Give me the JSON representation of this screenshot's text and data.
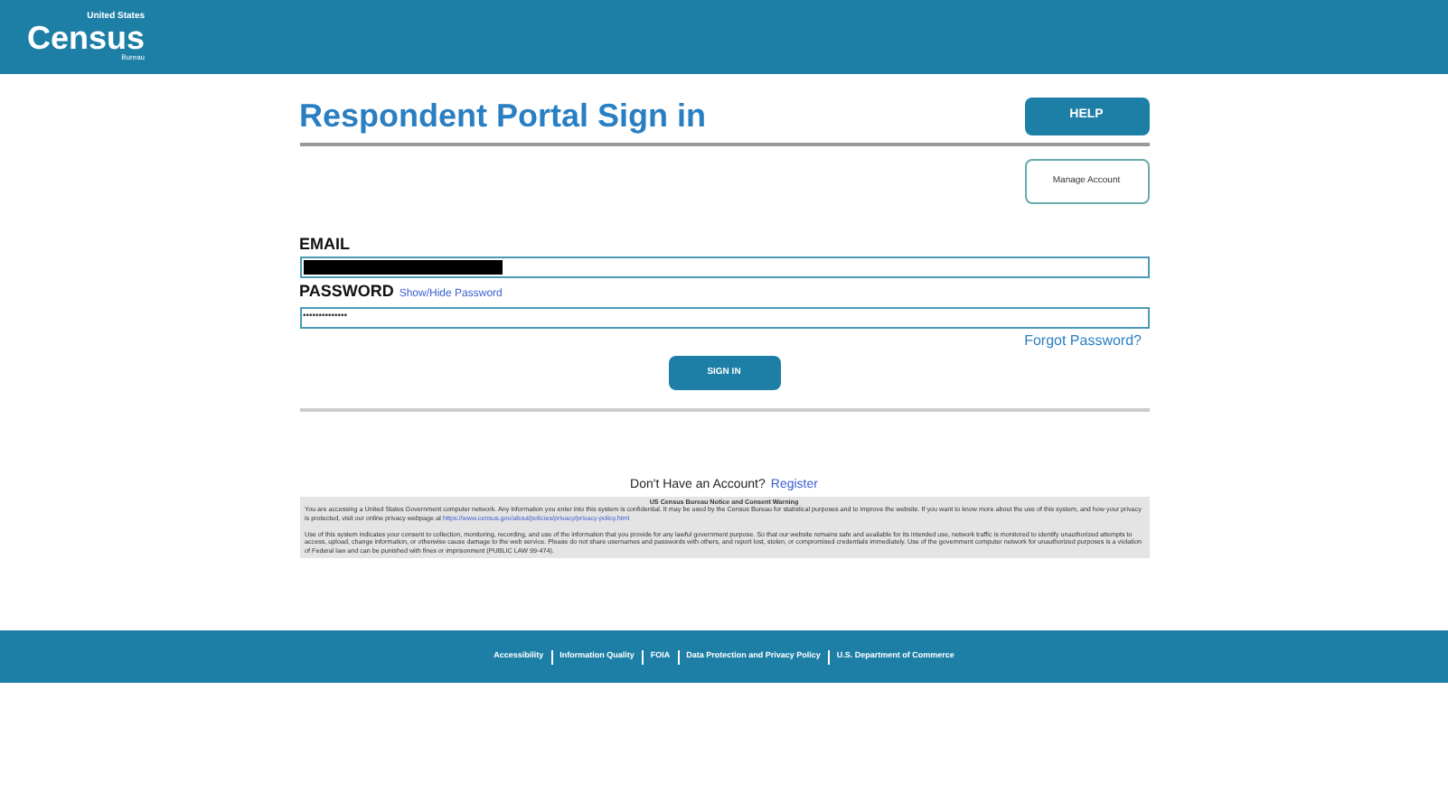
{
  "header": {
    "logo_top": "United States",
    "logo_main": "Census",
    "logo_bottom": "Bureau"
  },
  "title": "Respondent Portal Sign in",
  "help_button": "HELP",
  "manage_button": "Manage Account",
  "email": {
    "label": "EMAIL",
    "redacted": true
  },
  "password": {
    "label": "PASSWORD",
    "toggle_link": "Show/Hide Password",
    "value": "••••••••••••••"
  },
  "forgot_link": "Forgot Password?",
  "sign_in_button": "SIGN IN",
  "register": {
    "prompt": "Don't Have an Account?",
    "link": "Register"
  },
  "notice": {
    "title": "US Census Bureau Notice and Consent Warning",
    "paragraph_1": "You are accessing a United States Government computer network. Any information you enter into this system is confidential. It may be used by the Census Bureau for statistical purposes and to improve the website. If you want to know more about the use of this system, and how your privacy is protected, visit our online privacy webpage at",
    "privacy_link": "https://www.census.gov/about/policies/privacy/privacy-policy.html",
    "paragraph_2": "Use of this system indicates your consent to collection, monitoring, recording, and use of the information that you provide for any lawful government purpose. So that our website remains safe and available for its intended use, network traffic is monitored to identify unauthorized attempts to access, upload, change information, or otherwise cause damage to the web service. Please do not share usernames and passwords with others, and report lost, stolen, or compromised credentials immediately. Use of the government computer network for unauthorized purposes is a violation of Federal law and can be punished with fines or imprisonment (PUBLIC LAW 99-474)."
  },
  "footer_links": [
    "Accessibility",
    "Information Quality",
    "FOIA",
    "Data Protection and Privacy Policy",
    "U.S. Department of Commerce"
  ]
}
